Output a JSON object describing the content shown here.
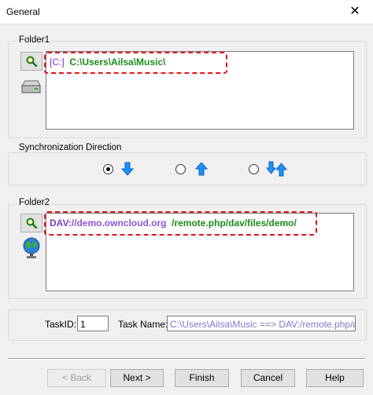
{
  "window": {
    "title": "General",
    "close_glyph": "✕"
  },
  "folder1": {
    "label": "Folder1",
    "drive": "[C:]",
    "path": "C:\\Users\\Ailsa\\Music\\",
    "browse_icon": "search-icon",
    "side_icon": "drive-icon"
  },
  "sync": {
    "label": "Synchronization Direction",
    "options": [
      {
        "direction": "down",
        "selected": true
      },
      {
        "direction": "up",
        "selected": false
      },
      {
        "direction": "both",
        "selected": false
      }
    ]
  },
  "folder2": {
    "label": "Folder2",
    "prefix": "DAV:",
    "host": "//demo.owncloud.org",
    "path": "/remote.php/dav/files/demo/",
    "browse_icon": "search-icon",
    "side_icon": "globe-icon"
  },
  "task": {
    "id_label": "TaskID:",
    "id_value": "1",
    "name_label": "Task Name:",
    "name_value": "C:\\Users\\Ailsa\\Music ==> DAV:/remote.php/dav."
  },
  "buttons": {
    "back": "< Back",
    "next": "Next >",
    "finish": "Finish",
    "cancel": "Cancel",
    "help": "Help"
  },
  "colors": {
    "highlight": "#e0141b",
    "arrow": "#1e90ff",
    "path_green": "#1a8c1a",
    "path_purple": "#7b3fbf"
  }
}
